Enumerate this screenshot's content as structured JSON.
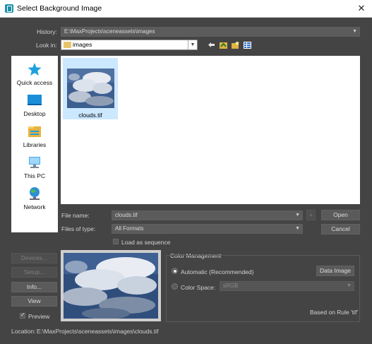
{
  "window": {
    "title": "Select Background Image",
    "close_glyph": "✕"
  },
  "history": {
    "label": "History:",
    "value": "E:\\MaxProjects\\sceneassets\\images"
  },
  "lookin": {
    "label": "Look in:",
    "value": "images"
  },
  "places": [
    {
      "label": "Quick access",
      "icon": "star-icon"
    },
    {
      "label": "Desktop",
      "icon": "desktop-icon"
    },
    {
      "label": "Libraries",
      "icon": "libraries-icon"
    },
    {
      "label": "This PC",
      "icon": "computer-icon"
    },
    {
      "label": "Network",
      "icon": "network-icon"
    }
  ],
  "files": [
    {
      "name": "clouds.tif"
    }
  ],
  "filename": {
    "label": "File name:",
    "value": "clouds.tif"
  },
  "filetype": {
    "label": "Files of type:",
    "value": "All Formats"
  },
  "buttons": {
    "open": "Open",
    "cancel": "Cancel",
    "plus": "+",
    "devices": "Devices...",
    "setup": "Setup...",
    "info": "Info...",
    "view": "View",
    "data_image": "Data Image"
  },
  "load_sequence": "Load as sequence",
  "preview_label": "Preview",
  "color_management": {
    "title": "Color Management",
    "automatic": "Automatic (Recommended)",
    "color_space_label": "Color Space:",
    "color_space_value": "sRGB",
    "rule": "Based on Rule 'tif'"
  },
  "location": {
    "label": "Location:",
    "value": "E:\\MaxProjects\\sceneassets\\images\\clouds.tif"
  },
  "colors": {
    "dialog_bg": "#444444",
    "selection": "#cce8ff",
    "accent_icon": "#1ea0e0"
  }
}
